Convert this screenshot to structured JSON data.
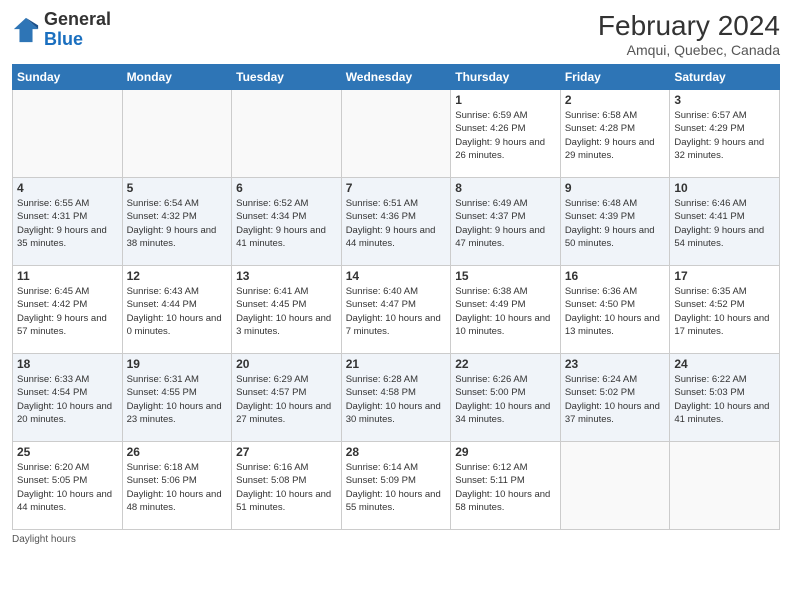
{
  "header": {
    "logo": {
      "general": "General",
      "blue": "Blue"
    },
    "title": "February 2024",
    "location": "Amqui, Quebec, Canada"
  },
  "calendar": {
    "days_of_week": [
      "Sunday",
      "Monday",
      "Tuesday",
      "Wednesday",
      "Thursday",
      "Friday",
      "Saturday"
    ],
    "weeks": [
      [
        {
          "day": "",
          "info": ""
        },
        {
          "day": "",
          "info": ""
        },
        {
          "day": "",
          "info": ""
        },
        {
          "day": "",
          "info": ""
        },
        {
          "day": "1",
          "info": "Sunrise: 6:59 AM\nSunset: 4:26 PM\nDaylight: 9 hours and 26 minutes."
        },
        {
          "day": "2",
          "info": "Sunrise: 6:58 AM\nSunset: 4:28 PM\nDaylight: 9 hours and 29 minutes."
        },
        {
          "day": "3",
          "info": "Sunrise: 6:57 AM\nSunset: 4:29 PM\nDaylight: 9 hours and 32 minutes."
        }
      ],
      [
        {
          "day": "4",
          "info": "Sunrise: 6:55 AM\nSunset: 4:31 PM\nDaylight: 9 hours and 35 minutes."
        },
        {
          "day": "5",
          "info": "Sunrise: 6:54 AM\nSunset: 4:32 PM\nDaylight: 9 hours and 38 minutes."
        },
        {
          "day": "6",
          "info": "Sunrise: 6:52 AM\nSunset: 4:34 PM\nDaylight: 9 hours and 41 minutes."
        },
        {
          "day": "7",
          "info": "Sunrise: 6:51 AM\nSunset: 4:36 PM\nDaylight: 9 hours and 44 minutes."
        },
        {
          "day": "8",
          "info": "Sunrise: 6:49 AM\nSunset: 4:37 PM\nDaylight: 9 hours and 47 minutes."
        },
        {
          "day": "9",
          "info": "Sunrise: 6:48 AM\nSunset: 4:39 PM\nDaylight: 9 hours and 50 minutes."
        },
        {
          "day": "10",
          "info": "Sunrise: 6:46 AM\nSunset: 4:41 PM\nDaylight: 9 hours and 54 minutes."
        }
      ],
      [
        {
          "day": "11",
          "info": "Sunrise: 6:45 AM\nSunset: 4:42 PM\nDaylight: 9 hours and 57 minutes."
        },
        {
          "day": "12",
          "info": "Sunrise: 6:43 AM\nSunset: 4:44 PM\nDaylight: 10 hours and 0 minutes."
        },
        {
          "day": "13",
          "info": "Sunrise: 6:41 AM\nSunset: 4:45 PM\nDaylight: 10 hours and 3 minutes."
        },
        {
          "day": "14",
          "info": "Sunrise: 6:40 AM\nSunset: 4:47 PM\nDaylight: 10 hours and 7 minutes."
        },
        {
          "day": "15",
          "info": "Sunrise: 6:38 AM\nSunset: 4:49 PM\nDaylight: 10 hours and 10 minutes."
        },
        {
          "day": "16",
          "info": "Sunrise: 6:36 AM\nSunset: 4:50 PM\nDaylight: 10 hours and 13 minutes."
        },
        {
          "day": "17",
          "info": "Sunrise: 6:35 AM\nSunset: 4:52 PM\nDaylight: 10 hours and 17 minutes."
        }
      ],
      [
        {
          "day": "18",
          "info": "Sunrise: 6:33 AM\nSunset: 4:54 PM\nDaylight: 10 hours and 20 minutes."
        },
        {
          "day": "19",
          "info": "Sunrise: 6:31 AM\nSunset: 4:55 PM\nDaylight: 10 hours and 23 minutes."
        },
        {
          "day": "20",
          "info": "Sunrise: 6:29 AM\nSunset: 4:57 PM\nDaylight: 10 hours and 27 minutes."
        },
        {
          "day": "21",
          "info": "Sunrise: 6:28 AM\nSunset: 4:58 PM\nDaylight: 10 hours and 30 minutes."
        },
        {
          "day": "22",
          "info": "Sunrise: 6:26 AM\nSunset: 5:00 PM\nDaylight: 10 hours and 34 minutes."
        },
        {
          "day": "23",
          "info": "Sunrise: 6:24 AM\nSunset: 5:02 PM\nDaylight: 10 hours and 37 minutes."
        },
        {
          "day": "24",
          "info": "Sunrise: 6:22 AM\nSunset: 5:03 PM\nDaylight: 10 hours and 41 minutes."
        }
      ],
      [
        {
          "day": "25",
          "info": "Sunrise: 6:20 AM\nSunset: 5:05 PM\nDaylight: 10 hours and 44 minutes."
        },
        {
          "day": "26",
          "info": "Sunrise: 6:18 AM\nSunset: 5:06 PM\nDaylight: 10 hours and 48 minutes."
        },
        {
          "day": "27",
          "info": "Sunrise: 6:16 AM\nSunset: 5:08 PM\nDaylight: 10 hours and 51 minutes."
        },
        {
          "day": "28",
          "info": "Sunrise: 6:14 AM\nSunset: 5:09 PM\nDaylight: 10 hours and 55 minutes."
        },
        {
          "day": "29",
          "info": "Sunrise: 6:12 AM\nSunset: 5:11 PM\nDaylight: 10 hours and 58 minutes."
        },
        {
          "day": "",
          "info": ""
        },
        {
          "day": "",
          "info": ""
        }
      ]
    ]
  },
  "footer": {
    "text": "Daylight hours"
  }
}
